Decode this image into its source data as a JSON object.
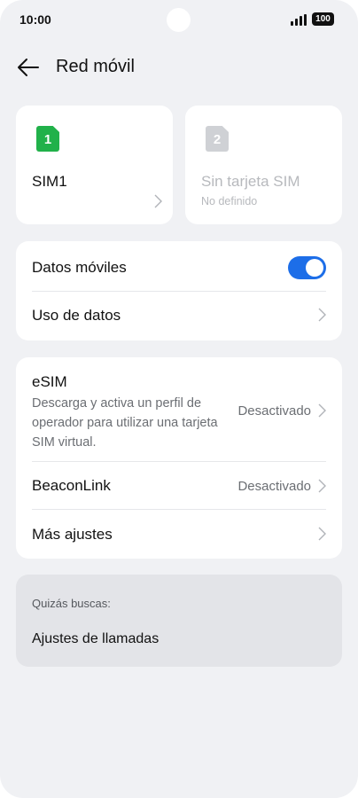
{
  "status_bar": {
    "time": "10:00",
    "battery": "100"
  },
  "header": {
    "title": "Red móvil"
  },
  "sims": [
    {
      "slot": "1",
      "name": "SIM1",
      "subtitle": "",
      "color": "#21b14a",
      "active": true
    },
    {
      "slot": "2",
      "name": "Sin tarjeta SIM",
      "subtitle": "No definido",
      "color": "#cfd1d5",
      "active": false
    }
  ],
  "data_card": {
    "mobile_data_label": "Datos móviles",
    "mobile_data_on": true,
    "data_usage_label": "Uso de datos"
  },
  "settings_card": {
    "esim": {
      "label": "eSIM",
      "description": "Descarga y activa un perfil de operador para utilizar una tarjeta SIM virtual.",
      "value": "Desactivado"
    },
    "beaconlink": {
      "label": "BeaconLink",
      "value": "Desactivado"
    },
    "more": {
      "label": "Más ajustes"
    }
  },
  "suggestions": {
    "heading": "Quizás buscas:",
    "items": [
      "Ajustes de llamadas"
    ]
  },
  "colors": {
    "accent": "#1d6ee8",
    "background": "#f0f1f4",
    "card": "#ffffff"
  }
}
